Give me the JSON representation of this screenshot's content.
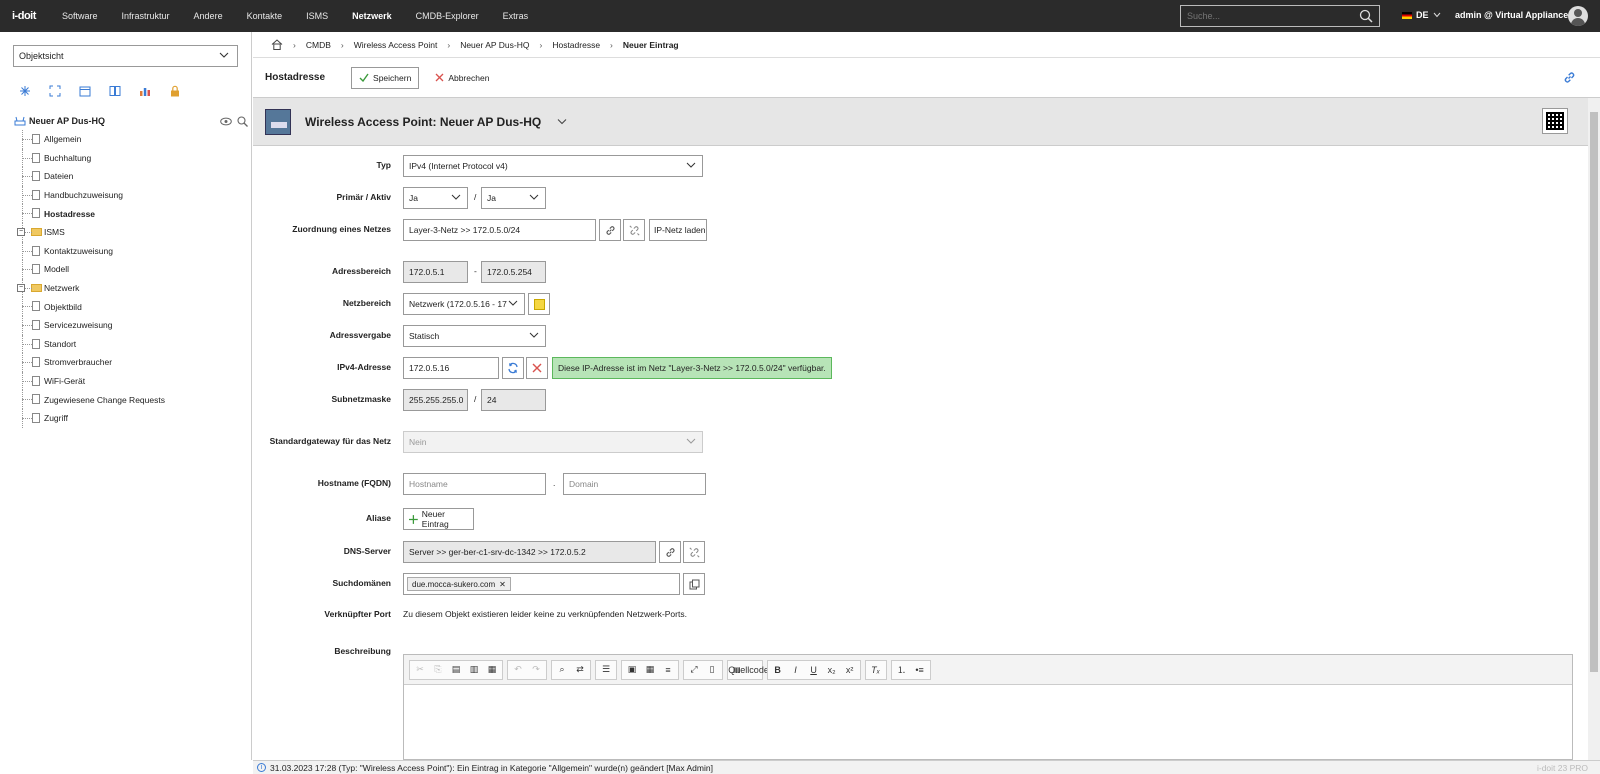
{
  "topbar": {
    "logo": "i-doit",
    "nav": [
      "Software",
      "Infrastruktur",
      "Andere",
      "Kontakte",
      "ISMS",
      "Netzwerk",
      "CMDB-Explorer",
      "Extras"
    ],
    "active_nav": "Netzwerk",
    "search_placeholder": "Suche...",
    "lang": "DE",
    "user": "admin @ Virtual Appliance"
  },
  "sidebar": {
    "view_select": "Objektsicht",
    "root": "Neuer AP Dus-HQ",
    "items": [
      {
        "label": "Allgemein",
        "kind": "doc"
      },
      {
        "label": "Buchhaltung",
        "kind": "doc"
      },
      {
        "label": "Dateien",
        "kind": "doc"
      },
      {
        "label": "Handbuchzuweisung",
        "kind": "doc"
      },
      {
        "label": "Hostadresse",
        "kind": "doc",
        "active": true
      },
      {
        "label": "ISMS",
        "kind": "folder"
      },
      {
        "label": "Kontaktzuweisung",
        "kind": "doc"
      },
      {
        "label": "Modell",
        "kind": "doc"
      },
      {
        "label": "Netzwerk",
        "kind": "folder"
      },
      {
        "label": "Objektbild",
        "kind": "doc"
      },
      {
        "label": "Servicezuweisung",
        "kind": "doc"
      },
      {
        "label": "Standort",
        "kind": "doc"
      },
      {
        "label": "Stromverbraucher",
        "kind": "doc"
      },
      {
        "label": "WiFi-Gerät",
        "kind": "doc"
      },
      {
        "label": "Zugewiesene Change Requests",
        "kind": "doc"
      },
      {
        "label": "Zugriff",
        "kind": "doc"
      }
    ]
  },
  "breadcrumb": [
    "CMDB",
    "Wireless Access Point",
    "Neuer AP Dus-HQ",
    "Hostadresse",
    "Neuer Eintrag"
  ],
  "actionbar": {
    "title": "Hostadresse",
    "save": "Speichern",
    "cancel": "Abbrechen"
  },
  "object": {
    "title": "Wireless Access Point: Neuer AP Dus-HQ"
  },
  "form": {
    "typ_label": "Typ",
    "typ_value": "IPv4 (Internet Protocol v4)",
    "primary_label": "Primär / Aktiv",
    "primary_value": "Ja",
    "active_value": "Ja",
    "net_label": "Zuordnung eines Netzes",
    "net_value": "Layer-3-Netz >> 172.0.5.0/24",
    "net_load": "IP-Netz laden",
    "range_label": "Adressbereich",
    "range_from": "172.0.5.1",
    "range_to": "172.0.5.254",
    "netrange_label": "Netzbereich",
    "netrange_value": "Netzwerk (172.0.5.16 - 17",
    "assign_label": "Adressvergabe",
    "assign_value": "Statisch",
    "ipv4_label": "IPv4-Adresse",
    "ipv4_value": "172.0.5.16",
    "ipv4_note": "Diese IP-Adresse ist im Netz \"Layer-3-Netz >> 172.0.5.0/24\" verfügbar.",
    "subnet_label": "Subnetzmaske",
    "subnet_value": "255.255.255.0",
    "cidr_value": "24",
    "gateway_label": "Standardgateway für das Netz",
    "gateway_value": "Nein",
    "hostname_label": "Hostname (FQDN)",
    "hostname_placeholder": "Hostname",
    "domain_placeholder": "Domain",
    "alias_label": "Aliase",
    "alias_button": "Neuer Eintrag",
    "dns_label": "DNS-Server",
    "dns_value": "Server >> ger-ber-c1-srv-dc-1342 >> 172.0.5.2",
    "search_label": "Suchdomänen",
    "search_tag": "due.mocca-sukero.com",
    "port_label": "Verknüpfter Port",
    "port_text": "Zu diesem Objekt existieren leider keine zu verknüpfenden Netzwerk-Ports.",
    "desc_label": "Beschreibung",
    "editor_source": "Quellcode"
  },
  "statusbar": {
    "message": "31.03.2023 17:28 (Typ: \"Wireless Access Point\"): Ein Eintrag in Kategorie \"Allgemein\" wurde(n) geändert [Max Admin]",
    "version": "i-doit 23 PRO"
  },
  "colors": {
    "topbar": "#2b2b2b",
    "ok_bg": "#b7e4b7",
    "ok_border": "#5cb85c",
    "accent": "#3a7bd5",
    "red": "#d9534f"
  }
}
